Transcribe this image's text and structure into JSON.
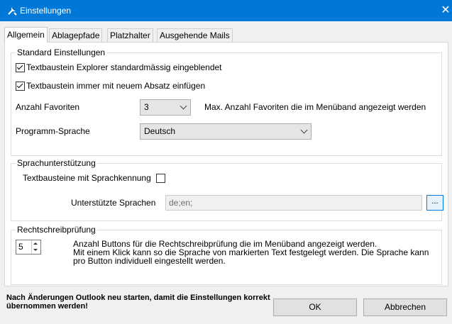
{
  "window": {
    "title": "Einstellungen",
    "close_glyph": "✕",
    "app_icon": "tools-icon"
  },
  "tabs": [
    {
      "label": "Allgemein",
      "active": true
    },
    {
      "label": "Ablagepfade",
      "active": false
    },
    {
      "label": "Platzhalter",
      "active": false
    },
    {
      "label": "Ausgehende Mails",
      "active": false
    }
  ],
  "standard": {
    "legend": "Standard Einstellungen",
    "explorer_label": "Textbaustein Explorer standardmässig eingeblendet",
    "explorer_checked": true,
    "paragraph_label": "Textbaustein immer mit neuem Absatz einfügen",
    "paragraph_checked": true,
    "favorites_label": "Anzahl Favoriten",
    "favorites_value": "3",
    "favorites_hint": "Max. Anzahl Favoriten die im Menüband angezeigt werden",
    "language_label": "Programm-Sprache",
    "language_value": "Deutsch"
  },
  "languages": {
    "legend": "Sprachunterstützung",
    "tagging_label": "Textbausteine mit Sprachkennung",
    "tagging_checked": false,
    "supported_label": "Unterstützte Sprachen",
    "supported_value": "de;en;",
    "browse_label": "..."
  },
  "spelling": {
    "legend": "Rechtschreibprüfung",
    "buttons_value": "5",
    "desc_line1": "Anzahl Buttons für die Rechtschreibprüfung die im Menüband angezeigt werden.",
    "desc_line2": "Mit einem Klick kann so die Sprache von markierten Text festgelegt werden. Die Sprache kann",
    "desc_line3": "pro Button individuell eingestellt werden."
  },
  "footer": {
    "restart_line1": "Nach Änderungen Outlook neu starten, damit die Einstellungen korrekt",
    "restart_line2": "übernommen werden!",
    "ok_label": "OK",
    "cancel_label": "Abbrechen"
  },
  "colors": {
    "titlebar": "#0078d7",
    "accent": "#0078d7"
  }
}
